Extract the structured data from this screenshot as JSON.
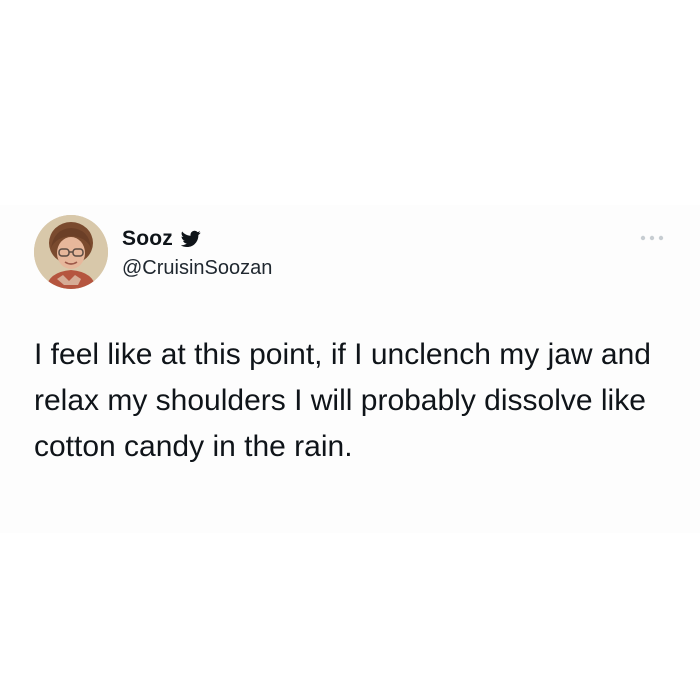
{
  "tweet": {
    "author": {
      "name": "Sooz",
      "handle": "@CruisinSoozan",
      "verified": true
    },
    "text": "I feel like at this point, if I unclench my jaw and relax my shoulders I will probably dissolve like cotton candy in the rain.",
    "more_icon": "more-horizontal-icon"
  },
  "colors": {
    "text": "#0f1419",
    "handle": "#202830",
    "more": "#c7cdd2",
    "verified_icon": "#0f1419",
    "card_background": "#fdfdfd"
  }
}
